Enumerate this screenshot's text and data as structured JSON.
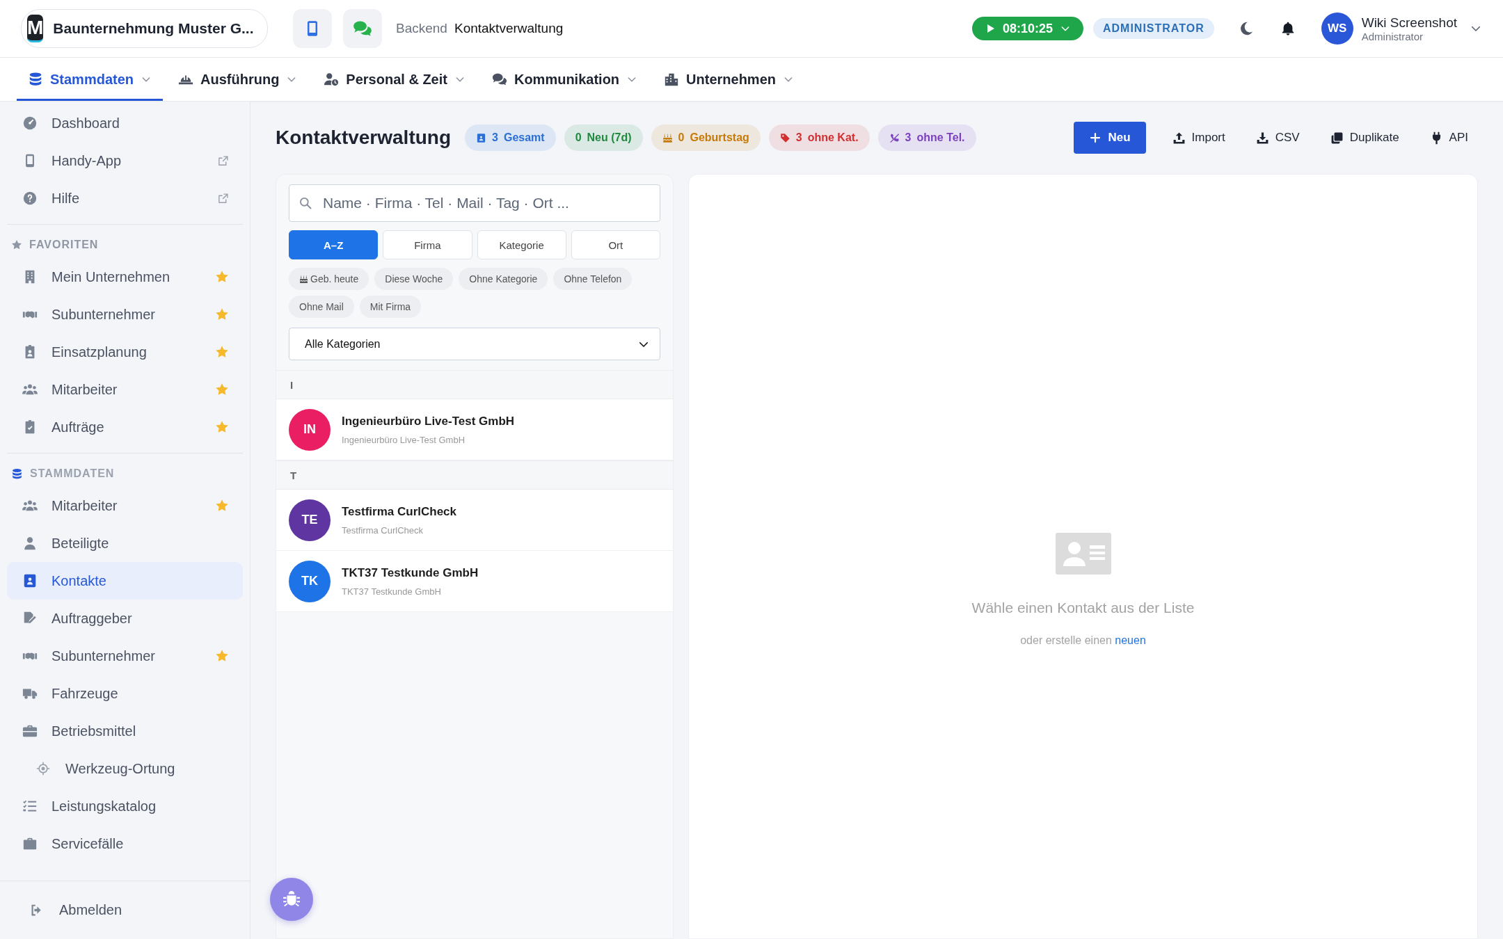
{
  "header": {
    "company": {
      "logo_letter": "M",
      "name": "Baunternehmung Muster G..."
    },
    "breadcrumb": {
      "section": "Backend",
      "page": "Kontaktverwaltung"
    },
    "timer": {
      "time": "08:10:25",
      "running": true
    },
    "role_badge": "ADMINISTRATOR",
    "user": {
      "initials": "WS",
      "name": "Wiki Screenshot",
      "role": "Administrator"
    }
  },
  "nav_tabs": [
    {
      "label": "Stammdaten",
      "selected": true
    },
    {
      "label": "Ausführung",
      "selected": false
    },
    {
      "label": "Personal & Zeit",
      "selected": false
    },
    {
      "label": "Kommunikation",
      "selected": false
    },
    {
      "label": "Unternehmen",
      "selected": false
    }
  ],
  "sidebar": {
    "top_items": [
      {
        "label": "Dashboard",
        "external": false
      },
      {
        "label": "Handy-App",
        "external": true
      },
      {
        "label": "Hilfe",
        "external": true
      }
    ],
    "favorites": {
      "heading": "FAVORITEN",
      "items": [
        {
          "label": "Mein Unternehmen",
          "starred": true
        },
        {
          "label": "Subunternehmer",
          "starred": true
        },
        {
          "label": "Einsatzplanung",
          "starred": true
        },
        {
          "label": "Mitarbeiter",
          "starred": true
        },
        {
          "label": "Aufträge",
          "starred": true
        }
      ]
    },
    "section": {
      "heading": "STAMMDATEN",
      "items": [
        {
          "label": "Mitarbeiter",
          "starred": true,
          "selected": false
        },
        {
          "label": "Beteiligte",
          "starred": false,
          "selected": false
        },
        {
          "label": "Kontakte",
          "starred": false,
          "selected": true
        },
        {
          "label": "Auftraggeber",
          "starred": false,
          "selected": false
        },
        {
          "label": "Subunternehmer",
          "starred": true,
          "selected": false
        },
        {
          "label": "Fahrzeuge",
          "starred": false,
          "selected": false
        },
        {
          "label": "Betriebsmittel",
          "starred": false,
          "selected": false,
          "children": [
            {
              "label": "Werkzeug-Ortung",
              "starred": false,
              "selected": false
            }
          ]
        },
        {
          "label": "Leistungskatalog",
          "starred": false,
          "selected": false
        },
        {
          "label": "Servicefälle",
          "starred": false,
          "selected": false
        }
      ]
    },
    "logout": "Abmelden"
  },
  "page": {
    "title": "Kontaktverwaltung",
    "stats": [
      {
        "count": "3",
        "label": "Gesamt",
        "color": "#2a6fd6"
      },
      {
        "count": "0",
        "label": "Neu (7d)",
        "color": "#1f8a3e"
      },
      {
        "count": "0",
        "label": "Geburtstag",
        "color": "#c77a0a"
      },
      {
        "count": "3",
        "label": "ohne Kat.",
        "color": "#d23030"
      },
      {
        "count": "3",
        "label": "ohne Tel.",
        "color": "#7b3fbf"
      }
    ],
    "actions": [
      {
        "label": "Neu",
        "kind": "primary"
      },
      {
        "label": "Import",
        "kind": "plain"
      },
      {
        "label": "CSV",
        "kind": "plain"
      },
      {
        "label": "Duplikate",
        "kind": "plain"
      },
      {
        "label": "API",
        "kind": "plain"
      }
    ]
  },
  "list": {
    "search": {
      "placeholder": "Name · Firma · Tel · Mail · Tag · Ort ..."
    },
    "sort_tabs": [
      {
        "label": "A–Z",
        "selected": true
      },
      {
        "label": "Firma",
        "selected": false
      },
      {
        "label": "Kategorie",
        "selected": false
      },
      {
        "label": "Ort",
        "selected": false
      }
    ],
    "filter_chips": [
      {
        "label": "Geb. heute"
      },
      {
        "label": "Diese Woche"
      },
      {
        "label": "Ohne Kategorie"
      },
      {
        "label": "Ohne Telefon"
      },
      {
        "label": "Ohne Mail"
      },
      {
        "label": "Mit Firma"
      }
    ],
    "category_select": {
      "value": "Alle Kategorien"
    },
    "groups": [
      {
        "letter": "I",
        "contacts": [
          {
            "initials": "IN",
            "name": "Ingenieurbüro Live-Test GmbH",
            "company": "Ingenieurbüro Live-Test GmbH",
            "color": "#e91e63"
          }
        ]
      },
      {
        "letter": "T",
        "contacts": [
          {
            "initials": "TE",
            "name": "Testfirma CurlCheck",
            "company": "Testfirma CurlCheck",
            "color": "#5e35a1"
          },
          {
            "initials": "TK",
            "name": "TKT37 Testkunde GmbH",
            "company": "TKT37 Testkunde GmbH",
            "color": "#1e74e6"
          }
        ]
      }
    ]
  },
  "detail": {
    "message": "Wähle einen Kontakt aus der Liste",
    "hint": "oder erstelle einen",
    "link": "neuen"
  }
}
